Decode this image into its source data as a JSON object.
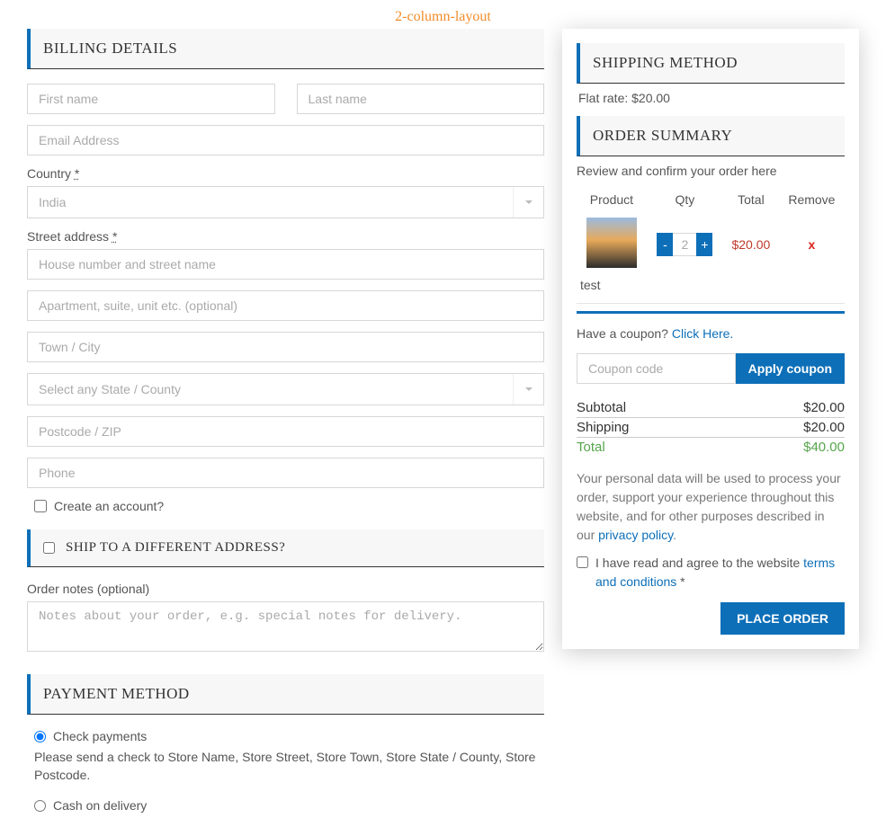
{
  "layout_label": "2-column-layout",
  "billing": {
    "heading": "BILLING DETAILS",
    "first_name_ph": "First name",
    "last_name_ph": "Last name",
    "email_ph": "Email Address",
    "country_label": "Country",
    "req_mark": "*",
    "country_value": "India",
    "street_label": "Street address",
    "street1_ph": "House number and street name",
    "street2_ph": "Apartment, suite, unit etc. (optional)",
    "city_ph": "Town / City",
    "state_ph": "Select any State / County",
    "postcode_ph": "Postcode / ZIP",
    "phone_ph": "Phone",
    "create_account_label": "Create an account?"
  },
  "ship_diff": {
    "label": "SHIP TO A DIFFERENT ADDRESS?"
  },
  "order_notes": {
    "label": "Order notes (optional)",
    "ph": "Notes about your order, e.g. special notes for delivery."
  },
  "payment": {
    "heading": "PAYMENT METHOD",
    "check_label": "Check payments",
    "check_desc": "Please send a check to Store Name, Store Street, Store Town, Store State / County, Store Postcode.",
    "cod_label": "Cash on delivery"
  },
  "shipping_method": {
    "heading": "SHIPPING METHOD",
    "flat_rate": "Flat rate: $20.00"
  },
  "summary": {
    "heading": "ORDER SUMMARY",
    "review_text": "Review and confirm your order here",
    "cols": {
      "product": "Product",
      "qty": "Qty",
      "total": "Total",
      "remove": "Remove"
    },
    "item": {
      "name": "test",
      "qty": "2",
      "total": "$20.00",
      "minus": "-",
      "plus": "+",
      "remove": "x"
    },
    "coupon_q": "Have a coupon?",
    "coupon_link": "Click Here.",
    "coupon_ph": "Coupon code",
    "apply_label": "Apply coupon",
    "subtotal_label": "Subtotal",
    "subtotal_val": "$20.00",
    "shipping_label": "Shipping",
    "shipping_val": "$20.00",
    "total_label": "Total",
    "total_val": "$40.00",
    "privacy_pre": "Your personal data will be used to process your order, support your experience throughout this website, and for other purposes described in our ",
    "privacy_link": "privacy policy",
    "privacy_post": ".",
    "terms_pre": "I have read and agree to the website ",
    "terms_link": "terms and conditions",
    "terms_post": " *",
    "place_order": "PLACE ORDER"
  }
}
